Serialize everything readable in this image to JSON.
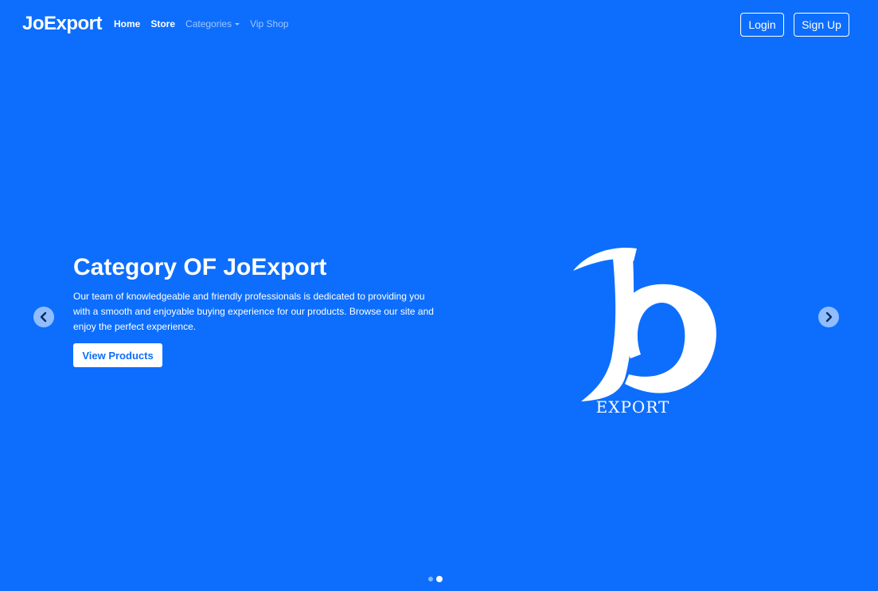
{
  "nav": {
    "brand": "JoExport",
    "links": [
      "Home",
      "Store",
      "Categories",
      "Vip Shop"
    ],
    "login": "Login",
    "signup": "Sign Up"
  },
  "hero": {
    "title": "Category OF JoExport",
    "text": "Our team of knowledgeable and friendly professionals is dedicated to providing you with a smooth and enjoyable buying experience for our products. Browse our site and enjoy the perfect experience.",
    "button": "View Products",
    "logo_text": "EXPORT"
  },
  "carousel": {
    "slide_count": 2,
    "active_index": 1
  },
  "colors": {
    "background": "#0d6efd",
    "accent": "#ffffff"
  }
}
